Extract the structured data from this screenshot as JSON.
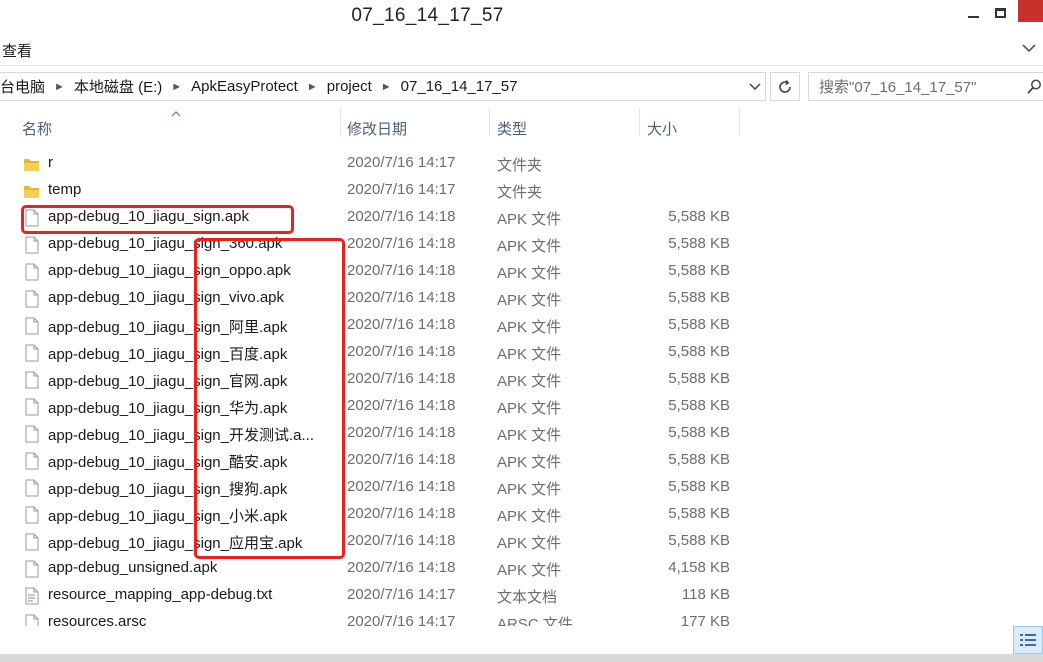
{
  "window": {
    "title": "07_16_14_17_57"
  },
  "ribbon": {
    "view_tab": "查看"
  },
  "address": {
    "crumbs": [
      "台电脑",
      "本地磁盘 (E:)",
      "ApkEasyProtect",
      "project",
      "07_16_14_17_57"
    ]
  },
  "search": {
    "placeholder": "搜索\"07_16_14_17_57\""
  },
  "columns": {
    "name": "名称",
    "modified": "修改日期",
    "type": "类型",
    "size": "大小"
  },
  "files": [
    {
      "name": "r",
      "date": "2020/7/16 14:17",
      "type": "文件夹",
      "size": "",
      "icon": "folder-icon"
    },
    {
      "name": "temp",
      "date": "2020/7/16 14:17",
      "type": "文件夹",
      "size": "",
      "icon": "folder-icon"
    },
    {
      "name": "app-debug_10_jiagu_sign.apk",
      "date": "2020/7/16 14:18",
      "type": "APK 文件",
      "size": "5,588 KB",
      "icon": "file-icon"
    },
    {
      "name": "app-debug_10_jiagu_sign_360.apk",
      "date": "2020/7/16 14:18",
      "type": "APK 文件",
      "size": "5,588 KB",
      "icon": "file-icon"
    },
    {
      "name": "app-debug_10_jiagu_sign_oppo.apk",
      "date": "2020/7/16 14:18",
      "type": "APK 文件",
      "size": "5,588 KB",
      "icon": "file-icon"
    },
    {
      "name": "app-debug_10_jiagu_sign_vivo.apk",
      "date": "2020/7/16 14:18",
      "type": "APK 文件",
      "size": "5,588 KB",
      "icon": "file-icon"
    },
    {
      "name": "app-debug_10_jiagu_sign_阿里.apk",
      "date": "2020/7/16 14:18",
      "type": "APK 文件",
      "size": "5,588 KB",
      "icon": "file-icon"
    },
    {
      "name": "app-debug_10_jiagu_sign_百度.apk",
      "date": "2020/7/16 14:18",
      "type": "APK 文件",
      "size": "5,588 KB",
      "icon": "file-icon"
    },
    {
      "name": "app-debug_10_jiagu_sign_官网.apk",
      "date": "2020/7/16 14:18",
      "type": "APK 文件",
      "size": "5,588 KB",
      "icon": "file-icon"
    },
    {
      "name": "app-debug_10_jiagu_sign_华为.apk",
      "date": "2020/7/16 14:18",
      "type": "APK 文件",
      "size": "5,588 KB",
      "icon": "file-icon"
    },
    {
      "name": "app-debug_10_jiagu_sign_开发测试.a...",
      "date": "2020/7/16 14:18",
      "type": "APK 文件",
      "size": "5,588 KB",
      "icon": "file-icon"
    },
    {
      "name": "app-debug_10_jiagu_sign_酷安.apk",
      "date": "2020/7/16 14:18",
      "type": "APK 文件",
      "size": "5,588 KB",
      "icon": "file-icon"
    },
    {
      "name": "app-debug_10_jiagu_sign_搜狗.apk",
      "date": "2020/7/16 14:18",
      "type": "APK 文件",
      "size": "5,588 KB",
      "icon": "file-icon"
    },
    {
      "name": "app-debug_10_jiagu_sign_小米.apk",
      "date": "2020/7/16 14:18",
      "type": "APK 文件",
      "size": "5,588 KB",
      "icon": "file-icon"
    },
    {
      "name": "app-debug_10_jiagu_sign_应用宝.apk",
      "date": "2020/7/16 14:18",
      "type": "APK 文件",
      "size": "5,588 KB",
      "icon": "file-icon"
    },
    {
      "name": "app-debug_unsigned.apk",
      "date": "2020/7/16 14:18",
      "type": "APK 文件",
      "size": "4,158 KB",
      "icon": "file-icon"
    },
    {
      "name": "resource_mapping_app-debug.txt",
      "date": "2020/7/16 14:17",
      "type": "文本文档",
      "size": "118 KB",
      "icon": "text-file-icon"
    },
    {
      "name": "resources.arsc",
      "date": "2020/7/16 14:17",
      "type": "ARSC 文件",
      "size": "177 KB",
      "icon": "file-icon"
    }
  ],
  "colors": {
    "annotation": "#e8231f",
    "folder": "#e8b923",
    "header_text": "#4c607a",
    "close_button": "#c7302b"
  }
}
